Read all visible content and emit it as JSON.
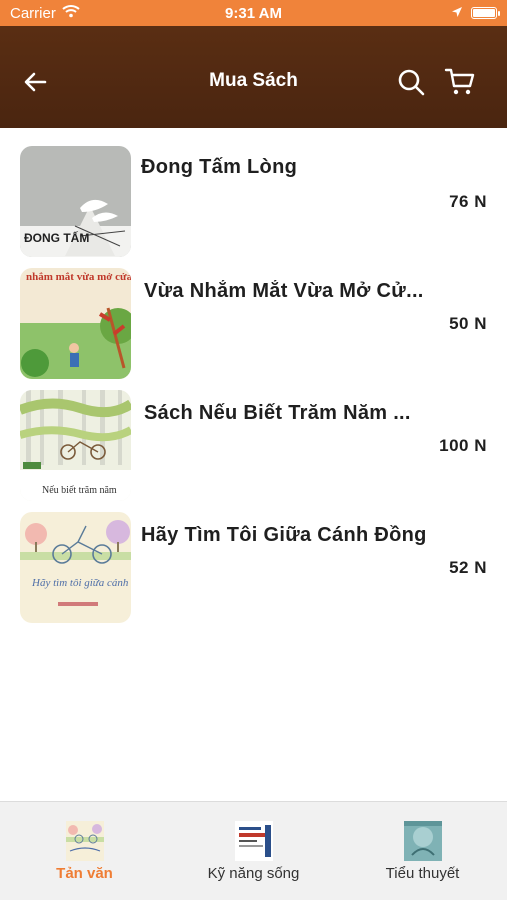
{
  "status_bar": {
    "carrier": "Carrier",
    "time": "9:31 AM",
    "battery_level": 1.0
  },
  "nav": {
    "title": "Mua Sách",
    "back_icon": "arrow-left-icon",
    "search_icon": "search-icon",
    "cart_icon": "cart-icon",
    "background": "#4f2812"
  },
  "books": [
    {
      "title": "Đong Tấm Lòng",
      "price": "76 N",
      "cover_text": "ĐONG TẤM"
    },
    {
      "title": "Vừa Nhắm Mắt Vừa Mở Cử...",
      "price": "50 N",
      "cover_text": "nhắm mắt vừa mở cửa sổ"
    },
    {
      "title": "Sách Nếu Biết Trăm Năm ...",
      "price": "100 N",
      "cover_text": "Nếu biết trăm năm"
    },
    {
      "title": "Hãy Tìm Tôi Giữa Cánh Đồng",
      "price": "52 N",
      "cover_text": "Hãy tìm tôi giữa cánh đồng"
    }
  ],
  "tabs": [
    {
      "label": "Tản văn",
      "active": true
    },
    {
      "label": "Kỹ năng sống",
      "active": false
    },
    {
      "label": "Tiểu thuyết",
      "active": false
    }
  ],
  "colors": {
    "status_bar": "#f0833a",
    "active_tab": "#ef7d34",
    "tab_bar": "#f1f1f1"
  }
}
